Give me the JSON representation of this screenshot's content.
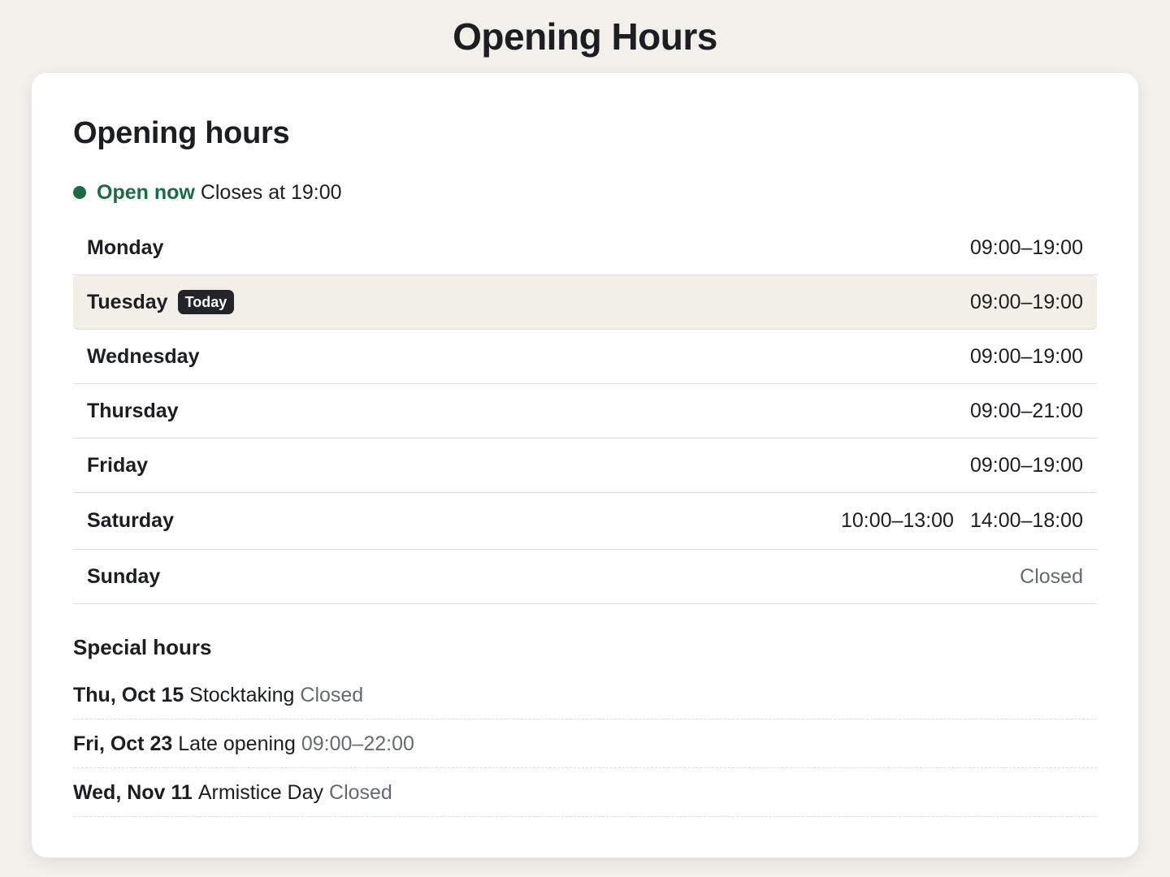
{
  "page": {
    "title": "Opening Hours"
  },
  "card": {
    "heading": "Opening hours",
    "status": {
      "label": "Open now",
      "detail": "Closes at 19:00",
      "color": "#1b6b43"
    },
    "days": [
      {
        "name": "Monday",
        "hours": [
          "09:00–19:00"
        ]
      },
      {
        "name": "Tuesday",
        "badge": "Today",
        "hours": [
          "09:00–19:00"
        ]
      },
      {
        "name": "Wednesday",
        "hours": [
          "09:00–19:00"
        ]
      },
      {
        "name": "Thursday",
        "hours": [
          "09:00–21:00"
        ]
      },
      {
        "name": "Friday",
        "hours": [
          "09:00–19:00"
        ]
      },
      {
        "name": "Saturday",
        "hours": [
          "10:00–13:00",
          "14:00–18:00"
        ]
      },
      {
        "name": "Sunday",
        "hours": [
          "Closed"
        ]
      }
    ],
    "special": {
      "heading": "Special hours",
      "items": [
        {
          "date": "Thu, Oct 15",
          "description": "Stocktaking",
          "status": "Closed"
        },
        {
          "date": "Fri, Oct 23",
          "description": "Late opening",
          "status": "09:00–22:00"
        },
        {
          "date": "Wed, Nov 11",
          "description": "Armistice Day",
          "status": "Closed"
        }
      ]
    }
  }
}
